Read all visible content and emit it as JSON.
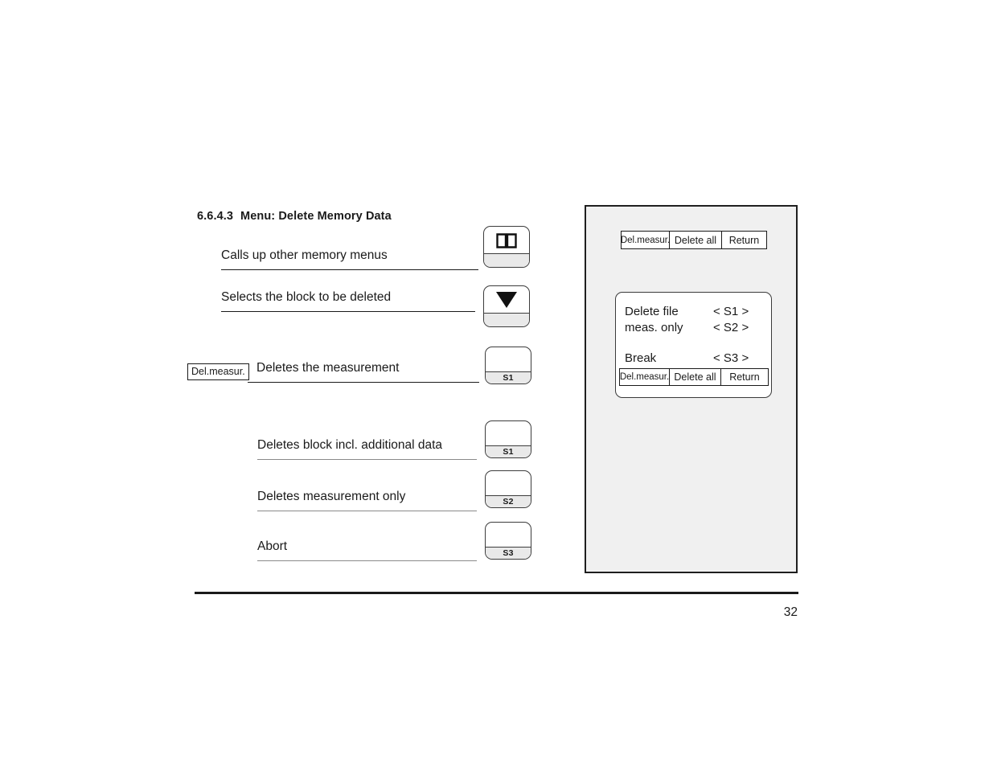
{
  "document": {
    "section_number": "6.6.4.3",
    "section_title": "Menu: Delete Memory Data",
    "page_number": "32"
  },
  "instructions": [
    {
      "label": "Calls up other memory menus",
      "key_icon": "book-icon",
      "key_label": ""
    },
    {
      "label": "Selects the block to be deleted",
      "key_icon": "triangle-down-icon",
      "key_label": ""
    },
    {
      "label": "Deletes the measurement",
      "key_icon": "",
      "key_label": "S1"
    },
    {
      "label": "Deletes block incl. additional data",
      "key_icon": "",
      "key_label": "S1"
    },
    {
      "label": "Deletes measurement only",
      "key_icon": "",
      "key_label": "S2"
    },
    {
      "label": "Abort",
      "key_icon": "",
      "key_label": "S3"
    }
  ],
  "callout": {
    "tag_label": "Del.measur."
  },
  "device": {
    "top_softkeys": [
      "Del.measur.",
      "Delete all",
      "Return"
    ],
    "screen": {
      "lines": [
        {
          "label": "Delete file",
          "value": "< S1 >"
        },
        {
          "label": "meas. only",
          "value": "< S2 >"
        },
        {
          "label": "Break",
          "value": "< S3 >"
        }
      ],
      "softkeys": [
        "Del.measur.",
        "Delete all",
        "Return"
      ]
    }
  },
  "colors": {
    "ink": "#1a1a1a",
    "panel_background": "#f0f0f0",
    "key_footer": "#e9e9e9",
    "rule_light": "#8a8a8a"
  }
}
